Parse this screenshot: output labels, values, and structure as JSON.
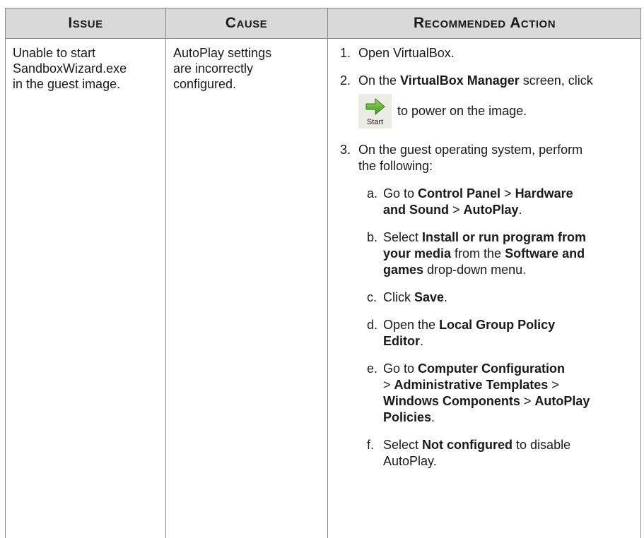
{
  "header": {
    "issue": "Issue",
    "cause": "Cause",
    "action": "Recommended Action"
  },
  "row": {
    "issue_lines": [
      "Unable to start",
      "SandboxWizard.exe",
      "in the guest image."
    ],
    "cause_lines": [
      "AutoPlay settings",
      "are incorrectly",
      "configured."
    ],
    "steps": {
      "s1": {
        "num": "1.",
        "text": "Open VirtualBox."
      },
      "s2": {
        "num": "2.",
        "t1": "On the ",
        "b1": "VirtualBox Manager",
        "t2": " screen, click",
        "icon_label": "Start",
        "t3": " to power on the image."
      },
      "s3": {
        "num": "3.",
        "line1": "On the guest operating system, perform",
        "line2": "the following:"
      }
    },
    "substeps": {
      "a": {
        "num": "a.",
        "t1": "Go to ",
        "b1": "Control Panel",
        "t2": " > ",
        "b2": "Hardware",
        "b3": "and Sound",
        "t3": " > ",
        "b4": "AutoPlay",
        "t4": "."
      },
      "b": {
        "num": "b.",
        "t1": "Select ",
        "b1": "Install or run program from",
        "b2": "your media",
        "t2": " from the ",
        "b3": "Software and",
        "b4": "games",
        "t3": " drop-down menu."
      },
      "c": {
        "num": "c.",
        "t1": "Click ",
        "b1": "Save",
        "t2": "."
      },
      "d": {
        "num": "d.",
        "t1": "Open the ",
        "b1": "Local Group Policy",
        "b2": "Editor",
        "t2": "."
      },
      "e": {
        "num": "e.",
        "t1": "Go to ",
        "b1": "Computer Configuration",
        "t2": "> ",
        "b2": "Administrative Templates",
        "t3": " >",
        "b3": "Windows Components",
        "t4": " > ",
        "b4": "AutoPlay",
        "b5": "Policies",
        "t5": "."
      },
      "f": {
        "num": "f.",
        "t1": "Select ",
        "b1": "Not configured",
        "t2": " to disable",
        "t3": "AutoPlay."
      }
    }
  },
  "colors": {
    "header_bg": "#d9d9d9",
    "border": "#888888",
    "icon_arrow": "#5bb02a"
  },
  "icons": [
    "start-arrow-icon"
  ]
}
